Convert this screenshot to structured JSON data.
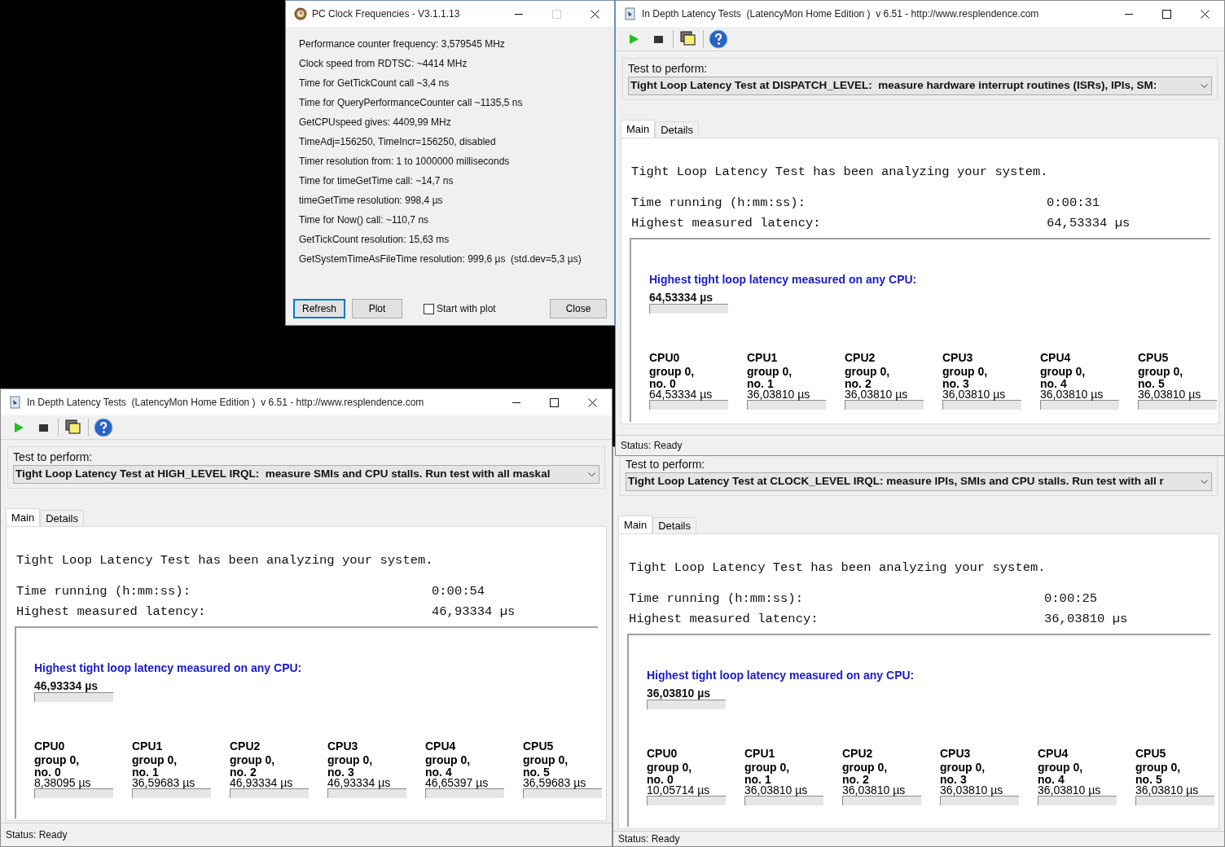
{
  "clock_window": {
    "title": "PC Clock Frequencies - V3.1.1.13",
    "lines": [
      "Performance counter frequency: 3,579545 MHz",
      "Clock speed from RDTSC: ~4414 MHz",
      "Time for GetTickCount call ~3,4 ns",
      "Time for QueryPerformanceCounter call ~1135,5 ns",
      "GetCPUspeed gives: 4409,99 MHz",
      "TimeAdj=156250, TimeIncr=156250, disabled",
      "Timer resolution from: 1 to 1000000 milliseconds",
      "Time for timeGetTime call: ~14,7 ns",
      "timeGetTime resolution: 998,4 µs",
      "Time for Now() call: ~110,7 ns",
      "GetTickCount resolution: 15,63 ms",
      "GetSystemTimeAsFileTime resolution: 999,6 µs  (std.dev=5,3 µs)"
    ],
    "buttons": [
      {
        "label": "Refresh",
        "default": true
      },
      {
        "label": "Plot",
        "default": false
      }
    ],
    "checkbox": {
      "label": "Start with plot",
      "checked": false
    },
    "close_button": "Close"
  },
  "latency_windows": [
    {
      "title": "In Depth Latency Tests  (LatencyMon Home Edition )  v 6.51 - http://www.resplendence.com",
      "test_label": "Test to perform:",
      "test_selection": "Tight Loop Latency Test at DISPATCH_LEVEL:  measure hardware interrupt routines (ISRs), IPIs, SM:",
      "tabs": [
        {
          "label": "Main",
          "selected": true
        },
        {
          "label": "Details",
          "selected": false
        }
      ],
      "summary": {
        "message": "Tight Loop Latency Test has been analyzing your system.",
        "time_label": "Time running (h:mm:ss):",
        "time_value": "0:00:31",
        "latency_label": "Highest measured latency:",
        "latency_value": "64,53334 µs"
      },
      "highest": {
        "heading": "Highest tight loop latency measured on any CPU:",
        "value": "64,53334 µs",
        "level": 0
      },
      "cpus": [
        {
          "name": "CPU0",
          "group": "group 0,",
          "no": "no. 0",
          "value": "64,53334 µs",
          "level": 0
        },
        {
          "name": "CPU1",
          "group": "group 0,",
          "no": "no. 1",
          "value": "36,03810 µs",
          "level": 0
        },
        {
          "name": "CPU2",
          "group": "group 0,",
          "no": "no. 2",
          "value": "36,03810 µs",
          "level": 0
        },
        {
          "name": "CPU3",
          "group": "group 0,",
          "no": "no. 3",
          "value": "36,03810 µs",
          "level": 0
        },
        {
          "name": "CPU4",
          "group": "group 0,",
          "no": "no. 4",
          "value": "36,03810 µs",
          "level": 0
        },
        {
          "name": "CPU5",
          "group": "group 0,",
          "no": "no. 5",
          "value": "36,03810 µs",
          "level": 0
        }
      ],
      "status": "Status: Ready"
    },
    {
      "title": "In Depth Latency Tests  (LatencyMon Home Edition )  v 6.51 - http://www.resplendence.com",
      "test_label": "Test to perform:",
      "test_selection": "Tight Loop Latency Test at HIGH_LEVEL IRQL:  measure SMIs and CPU stalls. Run test with all maskal",
      "tabs": [
        {
          "label": "Main",
          "selected": true
        },
        {
          "label": "Details",
          "selected": false
        }
      ],
      "summary": {
        "message": "Tight Loop Latency Test has been analyzing your system.",
        "time_label": "Time running (h:mm:ss):",
        "time_value": "0:00:54",
        "latency_label": "Highest measured latency:",
        "latency_value": "46,93334 µs"
      },
      "highest": {
        "heading": "Highest tight loop latency measured on any CPU:",
        "value": "46,93334 µs",
        "level": 0
      },
      "cpus": [
        {
          "name": "CPU0",
          "group": "group 0,",
          "no": "no. 0",
          "value": "8,38095 µs",
          "level": 0
        },
        {
          "name": "CPU1",
          "group": "group 0,",
          "no": "no. 1",
          "value": "36,59683 µs",
          "level": 0
        },
        {
          "name": "CPU2",
          "group": "group 0,",
          "no": "no. 2",
          "value": "46,93334 µs",
          "level": 0
        },
        {
          "name": "CPU3",
          "group": "group 0,",
          "no": "no. 3",
          "value": "46,93334 µs",
          "level": 0
        },
        {
          "name": "CPU4",
          "group": "group 0,",
          "no": "no. 4",
          "value": "46,65397 µs",
          "level": 0
        },
        {
          "name": "CPU5",
          "group": "group 0,",
          "no": "no. 5",
          "value": "36,59683 µs",
          "level": 0
        }
      ],
      "status": "Status: Ready"
    },
    {
      "test_label": "Test to perform:",
      "test_selection": "Tight Loop Latency Test at CLOCK_LEVEL IRQL: measure IPIs, SMIs and CPU stalls. Run test with all r",
      "tabs": [
        {
          "label": "Main",
          "selected": true
        },
        {
          "label": "Details",
          "selected": false
        }
      ],
      "summary": {
        "message": "Tight Loop Latency Test has been analyzing your system.",
        "time_label": "Time running (h:mm:ss):",
        "time_value": "0:00:25",
        "latency_label": "Highest measured latency:",
        "latency_value": "36,03810 µs"
      },
      "highest": {
        "heading": "Highest tight loop latency measured on any CPU:",
        "value": "36,03810 µs",
        "level": 0
      },
      "cpus": [
        {
          "name": "CPU0",
          "group": "group 0,",
          "no": "no. 0",
          "value": "10,05714 µs",
          "level": 0
        },
        {
          "name": "CPU1",
          "group": "group 0,",
          "no": "no. 1",
          "value": "36,03810 µs",
          "level": 0
        },
        {
          "name": "CPU2",
          "group": "group 0,",
          "no": "no. 2",
          "value": "36,03810 µs",
          "level": 0
        },
        {
          "name": "CPU3",
          "group": "group 0,",
          "no": "no. 3",
          "value": "36,03810 µs",
          "level": 0
        },
        {
          "name": "CPU4",
          "group": "group 0,",
          "no": "no. 4",
          "value": "36,03810 µs",
          "level": 0
        },
        {
          "name": "CPU5",
          "group": "group 0,",
          "no": "no. 5",
          "value": "36,03810 µs",
          "level": 0
        }
      ],
      "status": "Status: Ready"
    }
  ]
}
